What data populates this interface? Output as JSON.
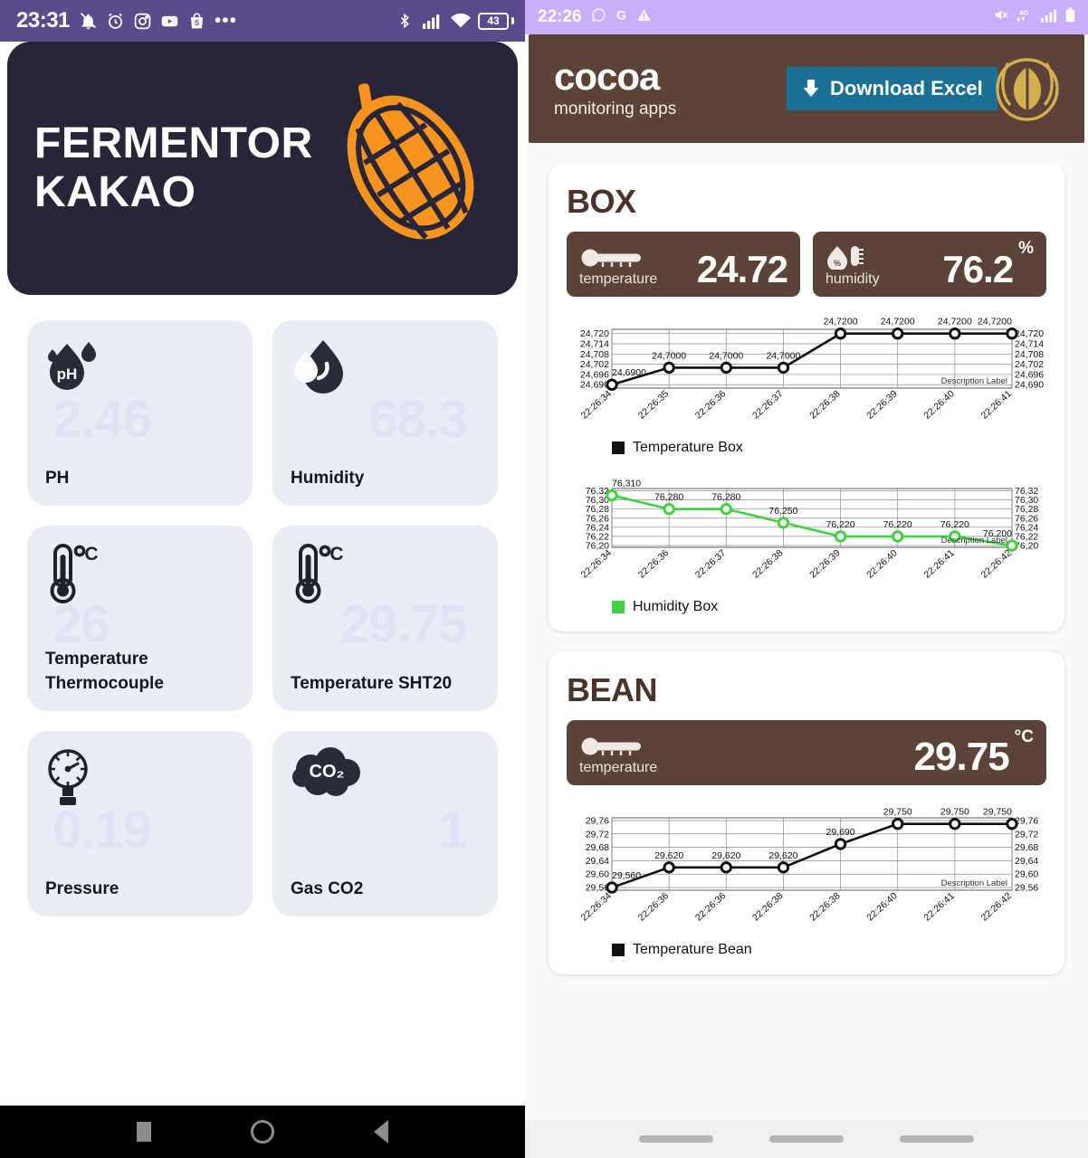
{
  "left_phone": {
    "statusbar": {
      "time": "23:31",
      "battery": "43",
      "left_icons": [
        "notification-off-icon",
        "alarm-icon",
        "instagram-icon",
        "youtube-icon",
        "shopee-icon",
        "more-dots-icon"
      ],
      "right_icons": [
        "bluetooth-icon",
        "signal-icon",
        "wifi-icon",
        "battery-icon"
      ]
    },
    "hero": {
      "title": "FERMENTOR\nKAKAO",
      "logo": "cocoa-pod-icon"
    },
    "cards": [
      {
        "icon": "ph-droplet-icon",
        "value": "2.46",
        "label": "PH"
      },
      {
        "icon": "humidity-droplet-icon",
        "value": "68.3",
        "label": "Humidity"
      },
      {
        "icon": "thermometer-celsius-icon",
        "value": "26",
        "label": "Temperature\nThermocouple"
      },
      {
        "icon": "thermometer-celsius-icon",
        "value": "29.75",
        "label": "Temperature SHT20"
      },
      {
        "icon": "pressure-gauge-icon",
        "value": "0.19",
        "label": "Pressure"
      },
      {
        "icon": "co2-cloud-icon",
        "value": "1",
        "label": "Gas CO2"
      }
    ],
    "navbar": [
      "recents-square-icon",
      "home-circle-icon",
      "back-triangle-icon"
    ]
  },
  "right_phone": {
    "statusbar": {
      "time": "22:26",
      "left_icons": [
        "whatsapp-icon",
        "google-icon",
        "warning-icon"
      ],
      "right_icons": [
        "mute-icon",
        "4g-icon",
        "signal-icon",
        "battery-icon"
      ]
    },
    "header": {
      "brand": "cocoa",
      "subtitle": "monitoring apps",
      "download_label": "Download Excel",
      "download_icon": "download-arrow-icon",
      "logo": "cocoa-bean-logo-icon",
      "bg_color": "#5b4338",
      "button_color": "#1a6f96"
    },
    "box_panel": {
      "title": "BOX",
      "stats": [
        {
          "icon": "thermometer-icon",
          "label": "temperature",
          "value": "24.72",
          "unit": ""
        },
        {
          "icon": "humidity-icon",
          "label": "humidity",
          "value": "76.2",
          "unit": "%"
        }
      ]
    },
    "bean_panel": {
      "title": "BEAN",
      "stats": [
        {
          "icon": "thermometer-icon",
          "label": "temperature",
          "value": "29.75",
          "unit": "°C"
        }
      ]
    },
    "navbar": [
      "nav-pill",
      "nav-pill",
      "nav-pill"
    ]
  },
  "chart_data": [
    {
      "id": "temperature-box-chart",
      "type": "line",
      "title": "",
      "legend": "Temperature Box",
      "legend_position": "bottom-left",
      "series_color": "#111111",
      "marker": "open-circle",
      "description_label": "Description Label",
      "grid": true,
      "x": [
        "22:26:34",
        "22:26:35",
        "22:26:36",
        "22:26:37",
        "22:26:38",
        "22:26:39",
        "22:26:40",
        "22:26:41"
      ],
      "values": [
        24.69,
        24.7,
        24.7,
        24.7,
        24.72,
        24.72,
        24.72,
        24.72
      ],
      "point_labels": [
        "24,6900",
        "24,7000",
        "24,7000",
        "24,7000",
        "24,7200",
        "24,7200",
        "24,7200",
        "24,7200"
      ],
      "yticks": [
        "24,690",
        "24,696",
        "24,702",
        "24,708",
        "24,714",
        "24,720"
      ],
      "ytick_values": [
        24.69,
        24.696,
        24.702,
        24.708,
        24.714,
        24.72
      ],
      "ylim": [
        24.688,
        24.7225
      ],
      "ylabel": "",
      "xlabel": ""
    },
    {
      "id": "humidity-box-chart",
      "type": "line",
      "title": "",
      "legend": "Humidity Box",
      "legend_position": "bottom-left",
      "series_color": "#3fd13f",
      "marker": "open-circle",
      "description_label": "Description Label",
      "grid": true,
      "x": [
        "22:26:34",
        "22:26:36",
        "22:26:37",
        "22:26:38",
        "22:26:39",
        "22:26:40",
        "22:26:41",
        "22:26:42"
      ],
      "values": [
        76.31,
        76.28,
        76.28,
        76.25,
        76.22,
        76.22,
        76.22,
        76.2
      ],
      "point_labels": [
        "76,310",
        "76,280",
        "76,280",
        "76,250",
        "76,220",
        "76,220",
        "76,220",
        "76,200"
      ],
      "yticks": [
        "76,20",
        "76,22",
        "76,24",
        "76,26",
        "76,28",
        "76,30",
        "76,32"
      ],
      "ytick_values": [
        76.2,
        76.22,
        76.24,
        76.26,
        76.28,
        76.3,
        76.32
      ],
      "ylim": [
        76.196,
        76.325
      ],
      "ylabel": "",
      "xlabel": ""
    },
    {
      "id": "temperature-bean-chart",
      "type": "line",
      "title": "",
      "legend": "Temperature Bean",
      "legend_position": "bottom-left",
      "series_color": "#111111",
      "marker": "open-circle",
      "description_label": "Description Label",
      "grid": true,
      "x": [
        "22:26:34",
        "22:26:36",
        "22:26:36",
        "22:26:38",
        "22:26:38",
        "22:26:40",
        "22:26:41",
        "22:26:42"
      ],
      "values": [
        29.56,
        29.62,
        29.62,
        29.62,
        29.69,
        29.75,
        29.75,
        29.75
      ],
      "point_labels": [
        "29,560",
        "29,620",
        "29,620",
        "29,620",
        "29,690",
        "29,750",
        "29,750",
        "29,750"
      ],
      "yticks": [
        "29,56",
        "29,60",
        "29,64",
        "29,68",
        "29,72",
        "29,76"
      ],
      "ytick_values": [
        29.56,
        29.6,
        29.64,
        29.68,
        29.72,
        29.76
      ],
      "ylim": [
        29.552,
        29.768
      ],
      "ylabel": "",
      "xlabel": ""
    }
  ]
}
